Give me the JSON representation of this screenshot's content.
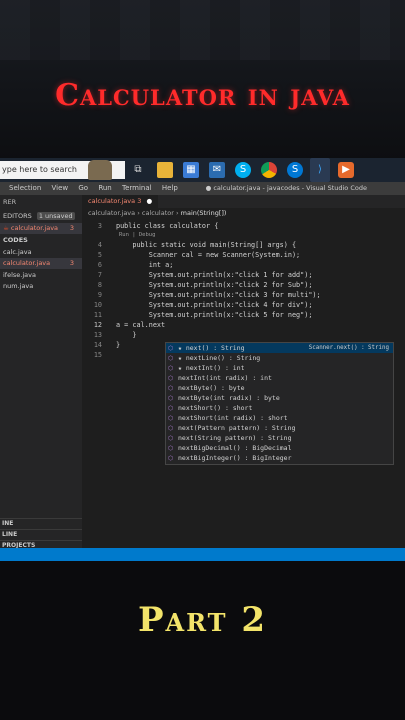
{
  "title": "Calculator in java",
  "footer": "Part 2",
  "taskbar": {
    "search_placeholder": "ype here to search"
  },
  "menu": [
    "Selection",
    "View",
    "Go",
    "Run",
    "Terminal",
    "Help"
  ],
  "window_title": "● calculator.java - javacodes - Visual Studio Code",
  "sidebar": {
    "header": "RER",
    "open_editors": "EDITORS",
    "unsaved_badge": "1 unsaved",
    "open_file": "calculator.java",
    "open_file_count": "3",
    "folder": "CODES",
    "files": [
      {
        "name": "calc.java",
        "count": ""
      },
      {
        "name": "calculator.java",
        "count": "3"
      },
      {
        "name": "ifelse.java",
        "count": ""
      },
      {
        "name": "num.java",
        "count": ""
      }
    ],
    "bottom": [
      "INE",
      "LINE",
      "PROJECTS"
    ]
  },
  "tab": {
    "label": "calculator.java",
    "count": "3"
  },
  "breadcrumb": {
    "file": "calculator.java",
    "cls": "calculator",
    "method": "main(String[])"
  },
  "code": {
    "codelens": "Run | Debug",
    "lines": [
      {
        "n": "3",
        "t": "public class calculator {"
      },
      {
        "n": "",
        "t": ""
      },
      {
        "n": "4",
        "t": "    public static void main(String[] args) {"
      },
      {
        "n": "5",
        "t": "        Scanner cal = new Scanner(System.in);"
      },
      {
        "n": "6",
        "t": "        int a;"
      },
      {
        "n": "7",
        "t": "        System.out.println(x:\"click 1 for add\");"
      },
      {
        "n": "8",
        "t": "        System.out.println(x:\"click 2 for Sub\");"
      },
      {
        "n": "9",
        "t": "        System.out.println(x:\"click 3 for multi\");"
      },
      {
        "n": "10",
        "t": "        System.out.println(x:\"click 4 for div\");"
      },
      {
        "n": "11",
        "t": "        System.out.println(x:\"click 5 for neg\");"
      },
      {
        "n": "12",
        "t": "a = cal.next"
      },
      {
        "n": "13",
        "t": "    }"
      },
      {
        "n": "14",
        "t": "}"
      },
      {
        "n": "15",
        "t": ""
      }
    ]
  },
  "suggest": {
    "detail": "Scanner.next() : String",
    "items": [
      "★ next() : String",
      "★ nextLine() : String",
      "★ nextInt() : int",
      "nextInt(int radix) : int",
      "nextByte() : byte",
      "nextByte(int radix) : byte",
      "nextShort() : short",
      "nextShort(int radix) : short",
      "next(Pattern pattern) : String",
      "next(String pattern) : String",
      "nextBigDecimal() : BigDecimal",
      "nextBigInteger() : BigInteger"
    ]
  }
}
